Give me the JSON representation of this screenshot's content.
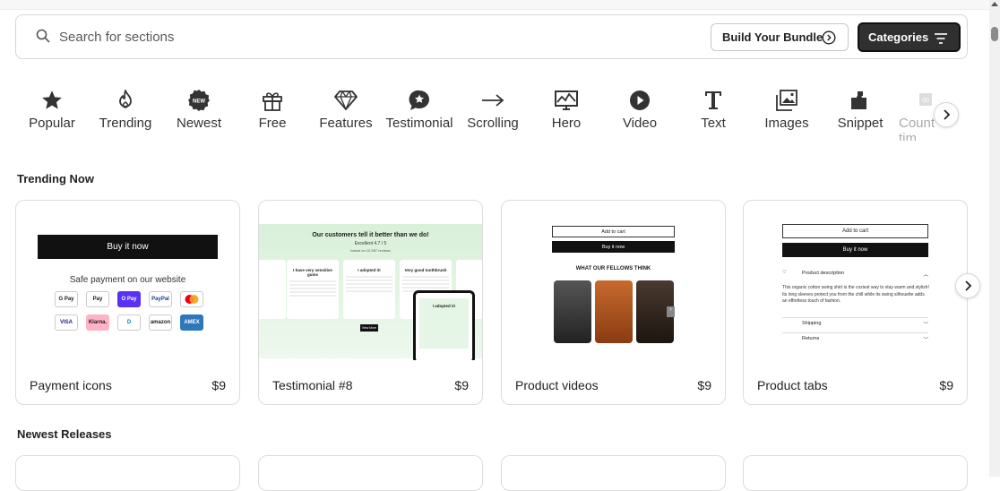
{
  "search": {
    "placeholder": "Search for sections"
  },
  "header": {
    "bundle_label": "Build Your Bundle",
    "categories_label": "Categories"
  },
  "categories": [
    {
      "label": "Popular",
      "icon": "star-icon"
    },
    {
      "label": "Trending",
      "icon": "flame-icon"
    },
    {
      "label": "Newest",
      "icon": "new-badge-icon"
    },
    {
      "label": "Free",
      "icon": "gift-icon"
    },
    {
      "label": "Features",
      "icon": "diamond-icon"
    },
    {
      "label": "Testimonial",
      "icon": "star-chat-icon"
    },
    {
      "label": "Scrolling",
      "icon": "arrow-right-icon"
    },
    {
      "label": "Hero",
      "icon": "chart-monitor-icon"
    },
    {
      "label": "Video",
      "icon": "play-icon"
    },
    {
      "label": "Text",
      "icon": "text-t-icon"
    },
    {
      "label": "Images",
      "icon": "images-icon"
    },
    {
      "label": "Snippet",
      "icon": "puzzle-icon"
    },
    {
      "label": "Count tim",
      "icon": "countdown-icon"
    }
  ],
  "trending": {
    "title": "Trending Now",
    "cards": [
      {
        "title": "Payment icons",
        "price": "$9"
      },
      {
        "title": "Testimonial #8",
        "price": "$9"
      },
      {
        "title": "Product videos",
        "price": "$9"
      },
      {
        "title": "Product tabs",
        "price": "$9"
      }
    ]
  },
  "newest": {
    "title": "Newest Releases"
  },
  "previews": {
    "payment": {
      "buy_label": "Buy it now",
      "safe_text": "Safe payment on our website",
      "row1": [
        "G Pay",
        "Pay",
        "O Pay",
        "PayPal",
        "mc"
      ],
      "row2": [
        "VISA",
        "Klarna.",
        "D",
        "amazon",
        "AMEX"
      ]
    },
    "testimonial": {
      "heading": "Our customers tell it better than we do!",
      "rating": "Excellent 4.7 / 5",
      "based": "based on 12,987 reviews",
      "cards": [
        "I have very sensitive gums",
        "I adopted it!",
        "Very good toothbrush"
      ],
      "phone_title": "I adopted it!",
      "cta": "View More"
    },
    "videos": {
      "add": "Add to cart",
      "buy": "Buy it now",
      "heading": "WHAT OUR FELLOWS THINK"
    },
    "tabs": {
      "add": "Add to cart",
      "buy": "Buy it now",
      "tab1": "Product description",
      "desc": "This organic cotton swing shirt is the coziest way to stay warm and stylish! Its long sleeves protect you from the chill while its swing silhouette adds an effortless touch of fashion.",
      "tab2": "Shipping",
      "tab3": "Returns"
    }
  }
}
